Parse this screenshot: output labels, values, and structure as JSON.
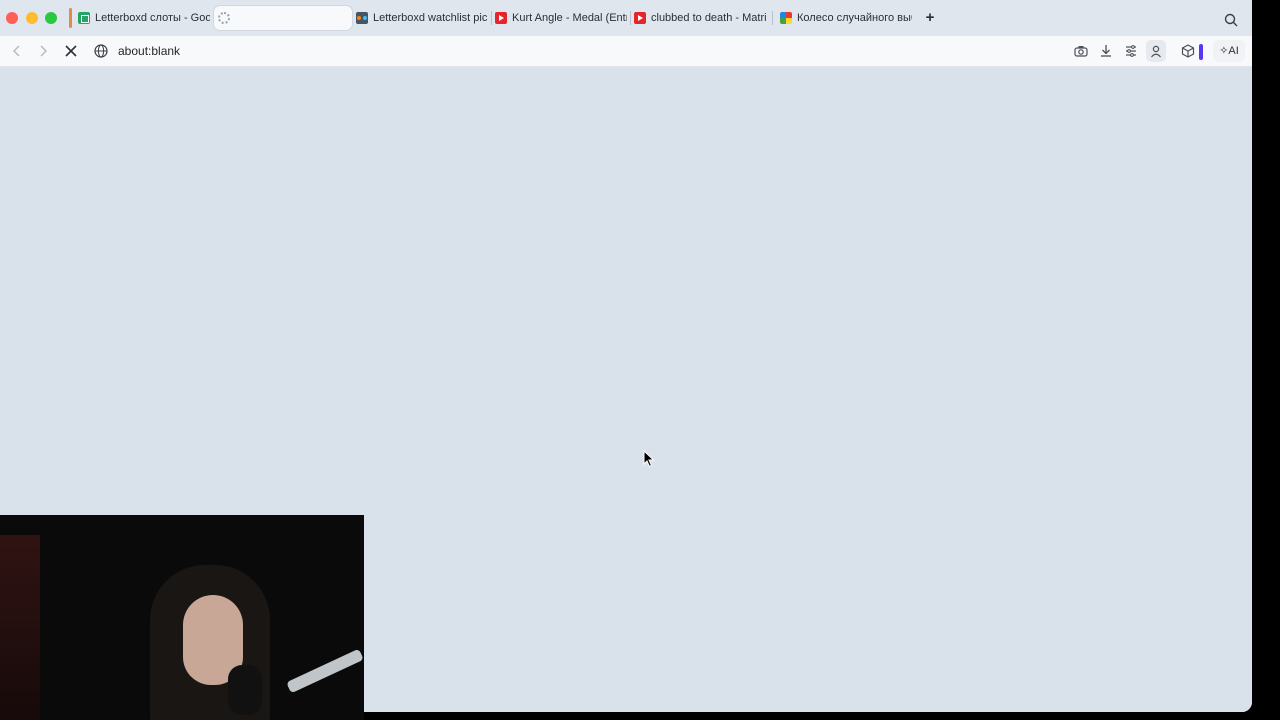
{
  "tabs": [
    {
      "title": "Letterboxd слоты - Goog",
      "favicon": "google-sheets-icon"
    },
    {
      "title": "",
      "favicon": "loading-spinner-icon",
      "active": true
    },
    {
      "title": "Letterboxd watchlist pick",
      "favicon": "letterboxd-icon"
    },
    {
      "title": "Kurt Angle - Medal (Entr",
      "favicon": "youtube-icon"
    },
    {
      "title": "clubbed to death - Matri",
      "favicon": "youtube-icon"
    },
    {
      "title": "Колесо случайного выб",
      "favicon": "wheel-icon"
    }
  ],
  "toolbar": {
    "url": "about:blank",
    "ai_label": "AI"
  },
  "colors": {
    "content_bg": "#d9e1ea",
    "accent": "#5b35f5"
  }
}
